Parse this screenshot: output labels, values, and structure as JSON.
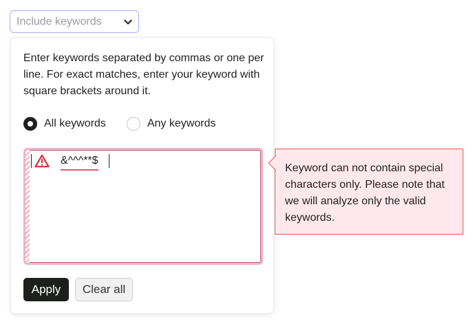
{
  "dropdown": {
    "label": "Include keywords",
    "icon": "chevron-down-icon"
  },
  "panel": {
    "instructions": "Enter keywords separated by commas or one per line. For exact matches, enter your keyword with square brackets around it.",
    "radio_options": [
      {
        "label": "All keywords",
        "checked": true
      },
      {
        "label": "Any keywords",
        "checked": false
      }
    ],
    "textarea": {
      "keyword": "&^^^**$",
      "warning_icon": "warning-triangle-icon",
      "state": "error"
    },
    "buttons": {
      "apply_label": "Apply",
      "clear_label": "Clear all"
    }
  },
  "error_tooltip": {
    "message": "Keyword can not contain special characters only. Please note that we will analyze only the valid keywords."
  },
  "colors": {
    "accent_border": "#a8adf0",
    "error_border": "#e2595c",
    "error_bg": "#ffe8ec",
    "warning_red": "#d92d3b",
    "primary_button": "#1d1f1d"
  }
}
